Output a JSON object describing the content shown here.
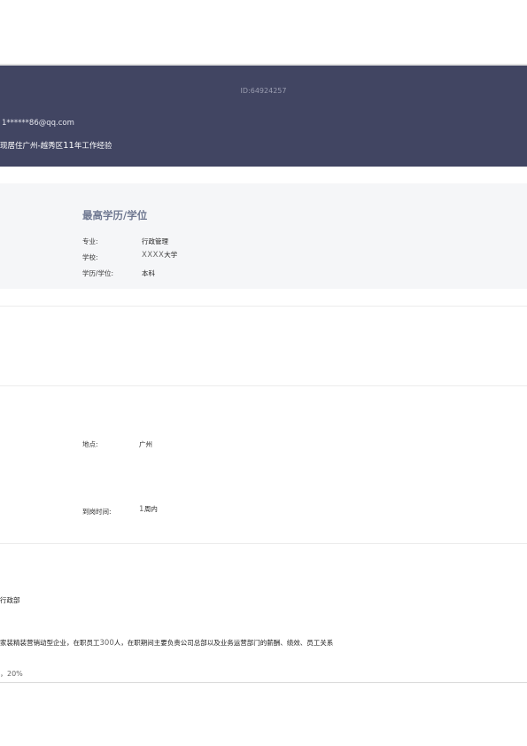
{
  "header": {
    "id_text": "ID:64924257",
    "email": "1******86@qq.com",
    "location_prefix": "现居住广州-越秀区",
    "years": "11",
    "location_suffix": "年工作经验"
  },
  "education": {
    "title": "最高学历/学位",
    "major_label": "专业:",
    "major_value": "行政管理",
    "school_label": "学校:",
    "school_value_prefix": "XXXX",
    "school_value_suffix": "大学",
    "degree_label": "学历/学位:",
    "degree_value": "本科"
  },
  "intention": {
    "location_label": "地点:",
    "location_value": "广州",
    "arrival_label": "到岗时间:",
    "arrival_number": "1",
    "arrival_unit": "周内"
  },
  "experience": {
    "department": "行政部",
    "desc_prefix": "家装精装营销动型企业，在职员工",
    "desc_number": "300",
    "desc_suffix": "人，在职期间主要负责公司总部以及业务运营部门的薪酬、绩效、员工关系",
    "percent": "，20%"
  }
}
